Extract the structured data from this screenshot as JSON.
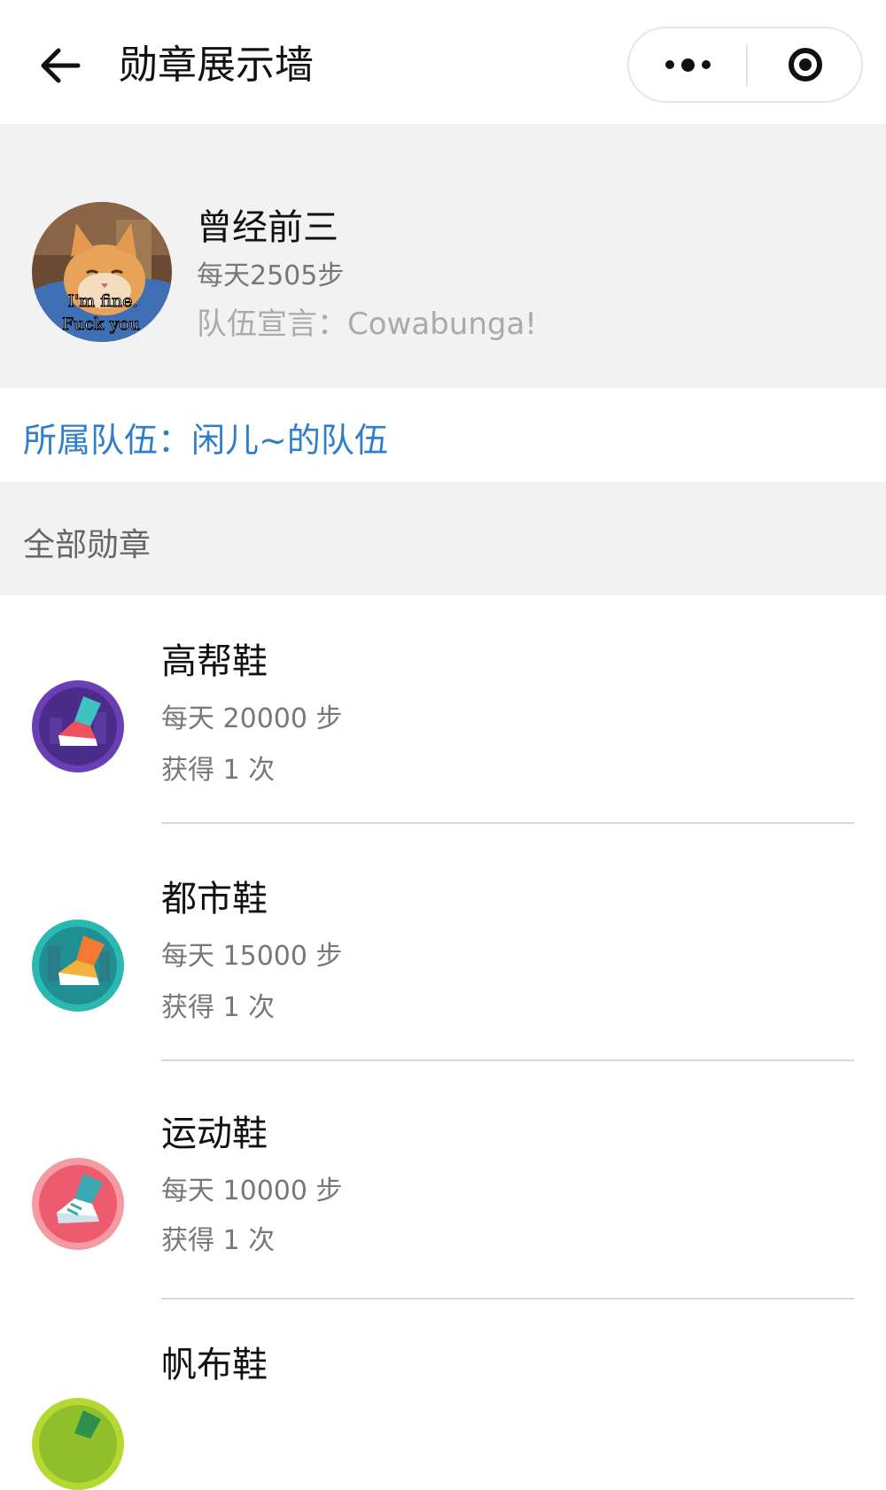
{
  "nav": {
    "title": "勋章展示墙",
    "back_icon": "arrow-left-icon",
    "more_icon": "more-dots-icon",
    "home_icon": "target-icon"
  },
  "profile": {
    "name": "曾经前三",
    "steps": "每天2505步",
    "motto": "队伍宣言：Cowabunga!",
    "avatar_caption_line1": "I'm fine.",
    "avatar_caption_line2": "Fuck you"
  },
  "team": {
    "label": "所属队伍：闲儿~的队伍"
  },
  "section": {
    "title": "全部勋章"
  },
  "badges": [
    {
      "name": "高帮鞋",
      "requirement": "每天 20000 步",
      "count": "获得 1 次",
      "color": "#6a3fb5",
      "icon": "high-top-shoe-icon"
    },
    {
      "name": "都市鞋",
      "requirement": "每天 15000 步",
      "count": "获得 1 次",
      "color": "#2bb8b0",
      "icon": "city-shoe-icon"
    },
    {
      "name": "运动鞋",
      "requirement": "每天 10000 步",
      "count": "获得 1 次",
      "color": "#ef5b6e",
      "icon": "sports-shoe-icon"
    },
    {
      "name": "帆布鞋",
      "requirement": "",
      "count": "",
      "color": "#b6d832",
      "icon": "canvas-shoe-icon"
    }
  ]
}
